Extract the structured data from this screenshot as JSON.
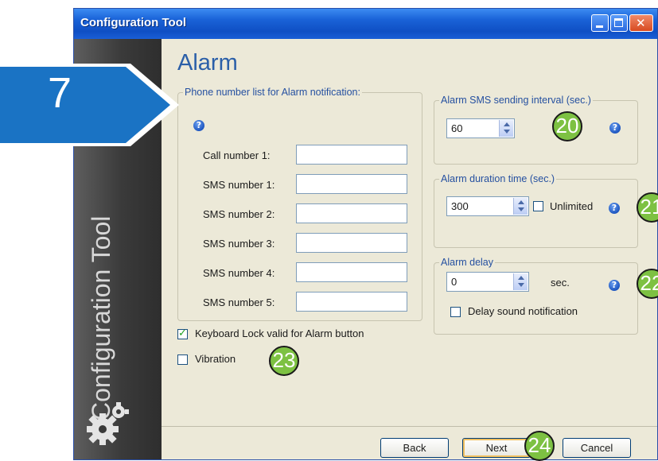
{
  "window": {
    "title": "Configuration Tool"
  },
  "sidebar": {
    "vertical_text": "Configuration Tool"
  },
  "page": {
    "title": "Alarm"
  },
  "phone_list": {
    "legend": "Phone number list for Alarm notification:",
    "fields": [
      {
        "label": "Call number 1:",
        "value": ""
      },
      {
        "label": "SMS number 1:",
        "value": ""
      },
      {
        "label": "SMS number 2:",
        "value": ""
      },
      {
        "label": "SMS number 3:",
        "value": ""
      },
      {
        "label": "SMS number 4:",
        "value": ""
      },
      {
        "label": "SMS number 5:",
        "value": ""
      }
    ]
  },
  "sms_interval": {
    "legend": "Alarm SMS sending interval (sec.)",
    "value": "60"
  },
  "duration": {
    "legend": "Alarm duration time (sec.)",
    "value": "300",
    "unlimited_label": "Unlimited",
    "unlimited_checked": false
  },
  "delay": {
    "legend": "Alarm delay",
    "value": "0",
    "unit": "sec.",
    "sound_label": "Delay sound notification",
    "sound_checked": false
  },
  "options": {
    "keyboard_lock_label": "Keyboard Lock valid for Alarm button",
    "keyboard_lock_checked": true,
    "vibration_label": "Vibration",
    "vibration_checked": false
  },
  "buttons": {
    "back": "Back",
    "next": "Next",
    "cancel": "Cancel"
  },
  "badges": {
    "step": "7",
    "callouts": [
      "20",
      "21",
      "22",
      "23",
      "24"
    ]
  },
  "colors": {
    "title_blue": "#2b5fa8",
    "step_blue": "#1a73c4",
    "callout_green": "#7dc142"
  }
}
